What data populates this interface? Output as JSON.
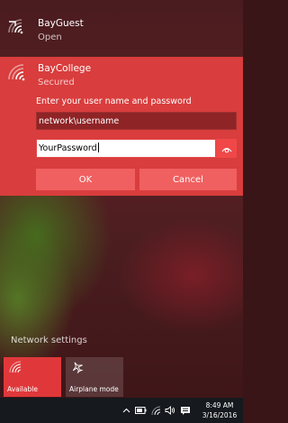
{
  "networks": [
    {
      "name": "BayGuest",
      "status": "Open"
    },
    {
      "name": "BayCollege",
      "status": "Secured"
    }
  ],
  "auth": {
    "prompt": "Enter your user name and password",
    "username_value": "network\\username",
    "password_value": "YourPassword",
    "ok_label": "OK",
    "cancel_label": "Cancel"
  },
  "settings": {
    "link_label": "Network settings"
  },
  "quick_actions": [
    {
      "label": "Available",
      "icon": "wifi-icon",
      "active": true
    },
    {
      "label": "Airplane mode",
      "icon": "airplane-icon",
      "active": false
    }
  ],
  "taskbar": {
    "time": "8:49 AM",
    "date": "3/16/2016"
  },
  "colors": {
    "accent": "#d93d3d",
    "button": "#f06060",
    "field_dark": "#8f2426",
    "taskbar": "#16191d"
  }
}
